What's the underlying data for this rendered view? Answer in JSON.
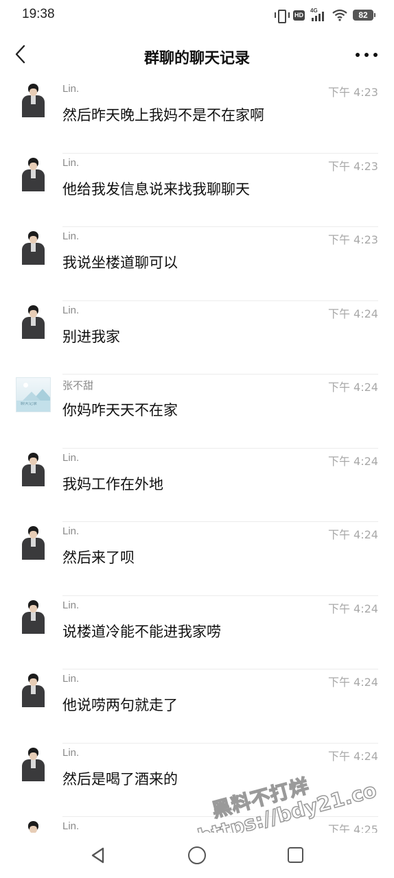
{
  "status_bar": {
    "time": "19:38",
    "hd_label": "HD",
    "network_label": "4G",
    "battery": "82"
  },
  "header": {
    "title": "群聊的聊天记录",
    "back_icon": "chevron-left-icon",
    "more_icon": "more-horizontal-icon"
  },
  "messages": [
    {
      "sender": "Lin.",
      "avatar": "lin",
      "time": "下午 4:23",
      "text": "然后昨天晚上我妈不是不在家啊"
    },
    {
      "sender": "Lin.",
      "avatar": "lin",
      "time": "下午 4:23",
      "text": "他给我发信息说来找我聊聊天"
    },
    {
      "sender": "Lin.",
      "avatar": "lin",
      "time": "下午 4:23",
      "text": "我说坐楼道聊可以"
    },
    {
      "sender": "Lin.",
      "avatar": "lin",
      "time": "下午 4:24",
      "text": "别进我家"
    },
    {
      "sender": "张不甜",
      "avatar": "zhang",
      "time": "下午 4:24",
      "text": "你妈咋天天不在家"
    },
    {
      "sender": "Lin.",
      "avatar": "lin",
      "time": "下午 4:24",
      "text": "我妈工作在外地"
    },
    {
      "sender": "Lin.",
      "avatar": "lin",
      "time": "下午 4:24",
      "text": "然后来了呗"
    },
    {
      "sender": "Lin.",
      "avatar": "lin",
      "time": "下午 4:24",
      "text": "说楼道冷能不能进我家唠"
    },
    {
      "sender": "Lin.",
      "avatar": "lin",
      "time": "下午 4:24",
      "text": "他说唠两句就走了"
    },
    {
      "sender": "Lin.",
      "avatar": "lin",
      "time": "下午 4:24",
      "text": "然后是喝了酒来的"
    },
    {
      "sender": "Lin.",
      "avatar": "lin",
      "time": "下午 4:25",
      "text": ""
    }
  ],
  "avatar_caption_zhang": "聊天记录",
  "watermark": {
    "line1": "黑料不打烊",
    "line2": "https://bdy21.co"
  },
  "nav_bar": {
    "back_icon": "triangle-back-icon",
    "home_icon": "circle-home-icon",
    "recents_icon": "square-recents-icon"
  },
  "colors": {
    "name": "#8a8a8a",
    "time": "#a8a8a8",
    "text": "#111111",
    "divider": "#ececec"
  }
}
